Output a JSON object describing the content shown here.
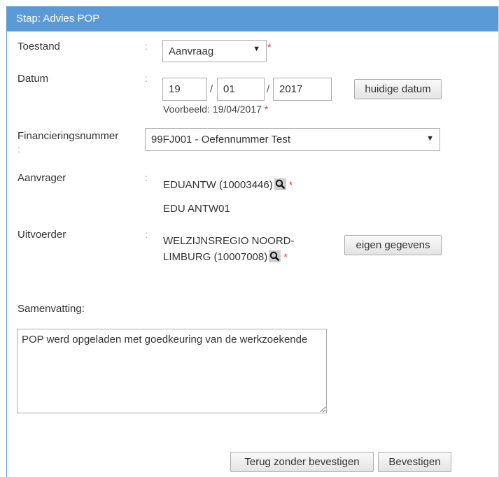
{
  "header": {
    "title": "Stap: Advies POP"
  },
  "colon": ":",
  "required_marker": "*",
  "form": {
    "toestand": {
      "label": "Toestand",
      "selected": "Aanvraag"
    },
    "datum": {
      "label": "Datum",
      "day": "19",
      "month": "01",
      "year": "2017",
      "separator": "/",
      "example": "Voorbeeld: 19/04/2017",
      "today_button": "huidige datum"
    },
    "financieringsnummer": {
      "label": "Financieringsnummer",
      "selected": "99FJ001 - Oefennummer Test"
    },
    "aanvrager": {
      "label": "Aanvrager",
      "value": "EDUANTW (10003446)",
      "name": "EDU ANTW01"
    },
    "uitvoerder": {
      "label": "Uitvoerder",
      "value_line1": "WELZIJNSREGIO NOORD-",
      "value_line2": "LIMBURG (10007008)",
      "own_data_button": "eigen gegevens"
    },
    "samenvatting": {
      "label": "Samenvatting:",
      "text": "POP werd opgeladen met goedkeuring van de werkzoekende"
    }
  },
  "footer": {
    "back_button": "Terug zonder bevestigen",
    "confirm_button": "Bevestigen"
  },
  "icons": {
    "search": "magnifier-icon",
    "dropdown": "triangle-down-icon",
    "resize": "resize-grip-icon"
  },
  "colors": {
    "header": "#5b9bd5",
    "required": "#e8323c"
  }
}
